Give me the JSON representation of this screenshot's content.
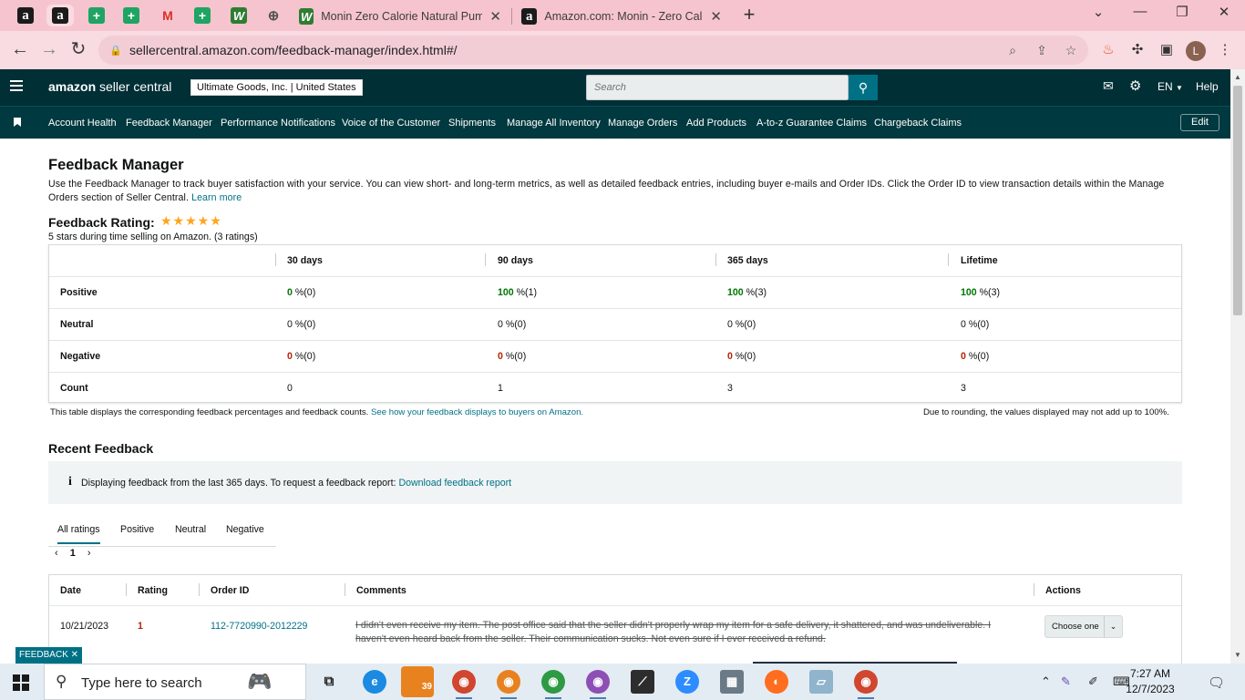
{
  "browser": {
    "tabs": [
      {
        "title": "Monin Zero Calorie Natural Pum",
        "close": "✕"
      },
      {
        "title": "Amazon.com: Monin - Zero Calo",
        "close": "✕"
      }
    ],
    "new_tab": "+",
    "window_controls": {
      "minimize": "—",
      "restore": "❐",
      "close": "✕"
    },
    "url": "sellercentral.amazon.com/feedback-manager/index.html#/",
    "profile_initial": "L"
  },
  "header": {
    "brand_bold": "amazon",
    "brand_rest": " seller central",
    "account": "Ultimate Goods, Inc. | United States",
    "search_placeholder": "Search",
    "language": "EN",
    "help": "Help"
  },
  "subnav": {
    "items": [
      "Account Health",
      "Feedback Manager",
      "Performance Notifications",
      "Voice of the Customer",
      "Shipments",
      "Manage All Inventory",
      "Manage Orders",
      "Add Products",
      "A-to-z Guarantee Claims",
      "Chargeback Claims"
    ],
    "edit": "Edit"
  },
  "main": {
    "title": "Feedback Manager",
    "intro": "Use the Feedback Manager to track buyer satisfaction with your service. You can view short- and long-term metrics, as well as detailed feedback entries, including buyer e-mails and Order IDs. Click the Order ID to view transaction details within the Manage Orders section of Seller Central.",
    "learn_more": "Learn more",
    "rating_label": "Feedback Rating:",
    "stars": "★★★★★",
    "rating_stars": 5,
    "rating_summary": "5 stars during time selling on Amazon. (3 ratings)"
  },
  "feedback_table": {
    "headers": [
      "30 days",
      "90 days",
      "365 days",
      "Lifetime"
    ],
    "rows": [
      {
        "label": "Positive",
        "cells": [
          {
            "num": "0",
            "rest": " %(0)"
          },
          {
            "num": "100",
            "rest": " %(1)"
          },
          {
            "num": "100",
            "rest": " %(3)"
          },
          {
            "num": "100",
            "rest": " %(3)"
          }
        ]
      },
      {
        "label": "Neutral",
        "cells": [
          {
            "num": "0",
            "rest": " %(0)"
          },
          {
            "num": "0",
            "rest": " %(0)"
          },
          {
            "num": "0",
            "rest": " %(0)"
          },
          {
            "num": "0",
            "rest": " %(0)"
          }
        ]
      },
      {
        "label": "Negative",
        "cells": [
          {
            "num": "0",
            "rest": " %(0)"
          },
          {
            "num": "0",
            "rest": " %(0)"
          },
          {
            "num": "0",
            "rest": " %(0)"
          },
          {
            "num": "0",
            "rest": " %(0)"
          }
        ]
      },
      {
        "label": "Count",
        "cells": [
          {
            "num": "0",
            "rest": ""
          },
          {
            "num": "1",
            "rest": ""
          },
          {
            "num": "3",
            "rest": ""
          },
          {
            "num": "3",
            "rest": ""
          }
        ]
      }
    ],
    "note_left": "This table displays the corresponding feedback percentages and feedback counts.",
    "note_link": "See how your feedback displays to buyers on Amazon.",
    "note_right": "Due to rounding, the values displayed may not add up to 100%."
  },
  "recent": {
    "title": "Recent Feedback",
    "info_icon": "i",
    "info_text": "Displaying feedback from the last 365 days. To request a feedback report:",
    "info_link": "Download feedback report",
    "tabs": [
      "All ratings",
      "Positive",
      "Neutral",
      "Negative"
    ],
    "pager": {
      "prev": "‹",
      "page": "1",
      "next": "›"
    },
    "columns": [
      "Date",
      "Rating",
      "Order ID",
      "Comments",
      "Actions"
    ],
    "rows": [
      {
        "date": "10/21/2023",
        "rating": "1",
        "order_id": "112-7720990-2012229",
        "comment": "I didn't even receive my item. The post office said that the seller didn't properly wrap my item for a safe delivery, it shattered, and was undeliverable. I haven't even heard back from the seller. Their communication sucks. Not even sure if I ever received a refund.",
        "action": "Choose one"
      }
    ]
  },
  "feedback_widget": "FEEDBACK ✕",
  "taskbar": {
    "search_placeholder": "Type here to search",
    "badge": "39",
    "time": "7:27 AM",
    "date": "12/7/2023"
  }
}
